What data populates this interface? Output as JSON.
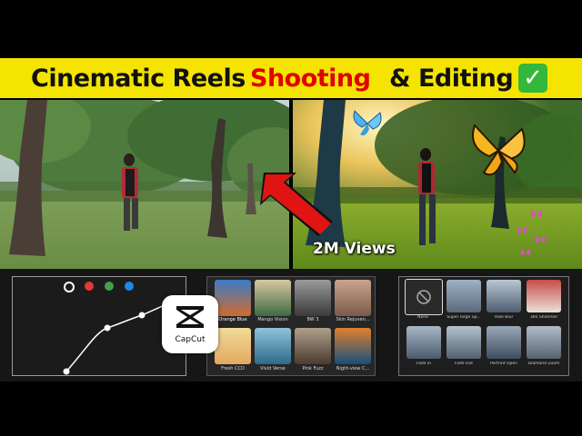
{
  "title": {
    "part1": "Cinematic Reels",
    "part2": "Shooting",
    "part3": "& Editing",
    "check": "✓",
    "highlight_color": "#e00000",
    "banner_color": "#f5e400"
  },
  "views_label": "2M Views",
  "curves": {
    "channel_colors": [
      "#ffffff",
      "#e53935",
      "#43a047",
      "#1e88e5"
    ]
  },
  "capcut": {
    "label": "CapCut"
  },
  "filters": [
    {
      "label": "Orange Blue"
    },
    {
      "label": "Mango Vision"
    },
    {
      "label": "BW 3"
    },
    {
      "label": "Skin Rejuven..."
    },
    {
      "label": "Fresh CCD"
    },
    {
      "label": "Vivid Verse"
    },
    {
      "label": "Pink Fuzz"
    },
    {
      "label": "Night-view C..."
    }
  ],
  "transitions": [
    {
      "label": "None"
    },
    {
      "label": "Super large Sp..."
    },
    {
      "label": "Halo Blur"
    },
    {
      "label": "360 Shimmer"
    },
    {
      "label": "Fade In"
    },
    {
      "label": "Fade Out"
    },
    {
      "label": "Portrait Open"
    },
    {
      "label": "Diamond Zoom"
    }
  ]
}
